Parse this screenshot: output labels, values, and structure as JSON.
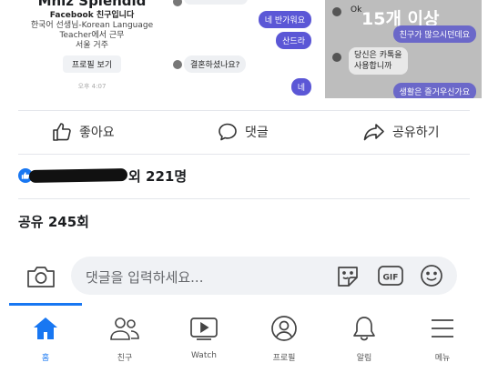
{
  "post_images": {
    "profile_card": {
      "name": "Mhiz Splendid",
      "friend_status": "Facebook 친구입니다",
      "bio_line1": "한국어 선생님-Korean Language",
      "bio_line2": "Teacher에서 근무",
      "location": "서울 거주",
      "profile_button": "프로필 보기",
      "time": "오후 4:07"
    },
    "chat": {
      "msg_greet": "네 반가워요",
      "msg_name": "산드라",
      "msg_married": "결혼하셨나요?",
      "msg_yes": "네"
    },
    "chat2": {
      "overlay": "15개 이상",
      "ok": "Ok",
      "msg_friends": "친구가 많으시던데요",
      "msg_kakao": "당신은 카톡을\n사용합니까",
      "msg_life": "생활은 즐거우신가요"
    }
  },
  "actions": {
    "like": "좋아요",
    "comment": "댓글",
    "share": "공유하기"
  },
  "reactions": {
    "count_text": "외 221명"
  },
  "shares": {
    "text": "공유 245회"
  },
  "composer": {
    "placeholder": "댓글을 입력하세요..."
  },
  "nav": {
    "home": "홈",
    "friends": "친구",
    "watch": "Watch",
    "profile": "프로필",
    "notifications": "알림",
    "menu": "메뉴"
  },
  "colors": {
    "brand": "#1877f2",
    "chat_bubble": "#5b57d6"
  },
  "icons": [
    "thumbs-up-icon",
    "comment-icon",
    "share-icon",
    "camera-icon",
    "sticker-icon",
    "gif-icon",
    "emoji-icon",
    "home-icon",
    "friends-icon",
    "watch-icon",
    "profile-icon",
    "bell-icon",
    "menu-icon"
  ]
}
